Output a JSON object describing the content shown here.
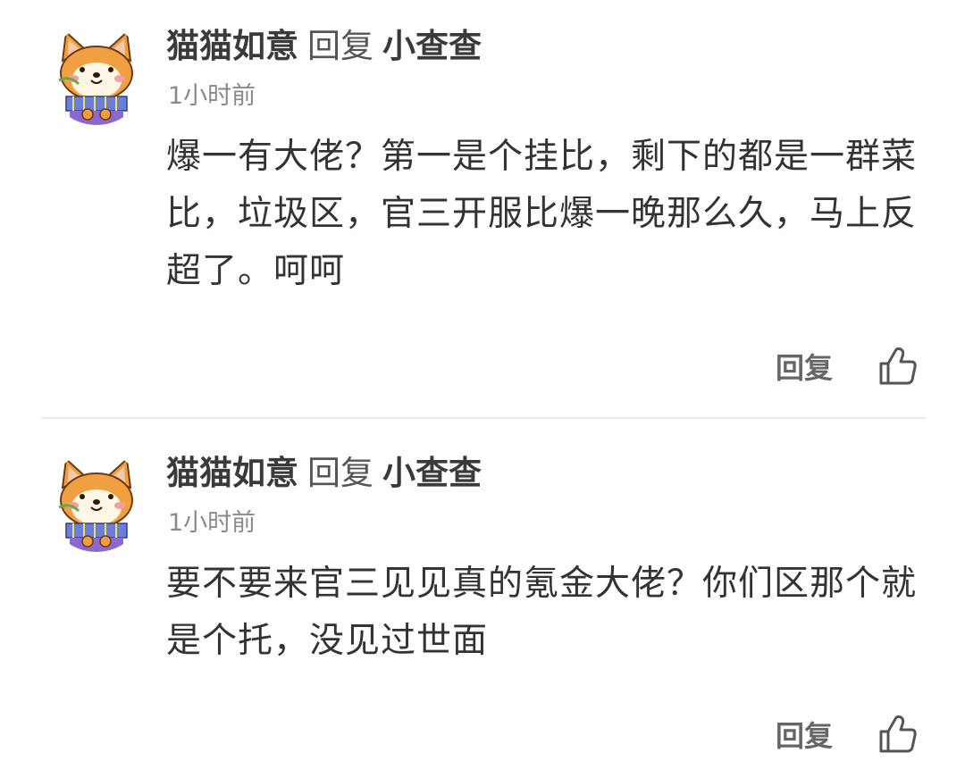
{
  "comments": [
    {
      "username": "猫猫如意",
      "reply_word": "回复",
      "target_user": "小查查",
      "time": "1小时前",
      "content": "爆一有大佬？第一是个挂比，剩下的都是一群菜比，垃圾区，官三开服比爆一晚那么久，马上反超了。呵呵",
      "reply_label": "回复",
      "avatar_icon": "shiba-dog-avatar-icon",
      "like_icon": "thumbs-up-icon"
    },
    {
      "username": "猫猫如意",
      "reply_word": "回复",
      "target_user": "小查查",
      "time": "1小时前",
      "content": "要不要来官三见见真的氪金大佬？你们区那个就是个托，没见过世面",
      "reply_label": "回复",
      "avatar_icon": "shiba-dog-avatar-icon",
      "like_icon": "thumbs-up-icon"
    }
  ],
  "colors": {
    "text_primary": "#333333",
    "text_secondary": "#8a8a8a",
    "divider": "#ebebeb",
    "avatar_fur": "#f0a040",
    "avatar_scarf": "#6b7fd6"
  }
}
